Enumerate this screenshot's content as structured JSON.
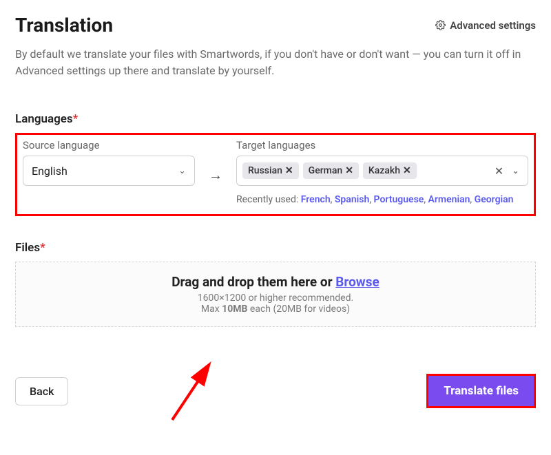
{
  "header": {
    "title": "Translation",
    "advanced_settings": "Advanced settings"
  },
  "description": "By default we translate your files with Smartwords, if you don't have or don't want — you can turn it off in Advanced settings up there and translate by yourself.",
  "languages": {
    "section_label": "Languages",
    "source_caption": "Source language",
    "source_value": "English",
    "target_caption": "Target languages",
    "target_tags": [
      "Russian",
      "German",
      "Kazakh"
    ],
    "recent_label": "Recently used: ",
    "recent_items": [
      "French",
      "Spanish",
      "Portuguese",
      "Armenian",
      "Georgian"
    ]
  },
  "files": {
    "section_label": "Files",
    "drop_main_1": "Drag and drop them here or ",
    "drop_browse": "Browse",
    "drop_sub1": "1600×1200 or higher recommended.",
    "drop_sub2_a": "Max ",
    "drop_sub2_b": "10MB",
    "drop_sub2_c": " each (20MB for videos)"
  },
  "buttons": {
    "back": "Back",
    "translate": "Translate files"
  }
}
